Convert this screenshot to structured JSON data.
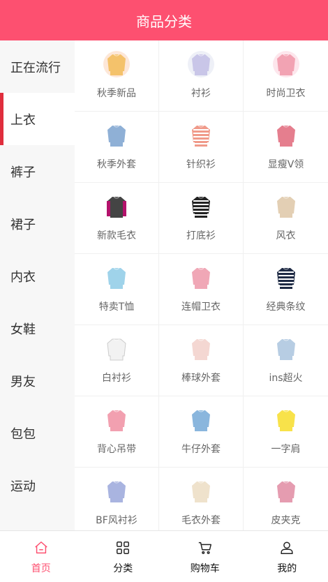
{
  "header": {
    "title": "商品分类"
  },
  "sidebar": {
    "items": [
      {
        "label": "正在流行"
      },
      {
        "label": "上衣"
      },
      {
        "label": "裤子"
      },
      {
        "label": "裙子"
      },
      {
        "label": "内衣"
      },
      {
        "label": "女鞋"
      },
      {
        "label": "男友"
      },
      {
        "label": "包包"
      },
      {
        "label": "运动"
      },
      {
        "label": ""
      }
    ],
    "active_index": 1
  },
  "grid": {
    "items": [
      {
        "label": "秋季新品",
        "icon": "sweater-icon"
      },
      {
        "label": "衬衫",
        "icon": "shirt-icon"
      },
      {
        "label": "时尚卫衣",
        "icon": "hoodie-icon"
      },
      {
        "label": "秋季外套",
        "icon": "jacket-icon"
      },
      {
        "label": "针织衫",
        "icon": "knit-icon"
      },
      {
        "label": "显瘦V领",
        "icon": "vneck-icon"
      },
      {
        "label": "新款毛衣",
        "icon": "sweater-icon"
      },
      {
        "label": "打底衫",
        "icon": "striped-top-icon"
      },
      {
        "label": "风衣",
        "icon": "trench-coat-icon"
      },
      {
        "label": "特卖T恤",
        "icon": "tshirt-icon"
      },
      {
        "label": "连帽卫衣",
        "icon": "hoodie-icon"
      },
      {
        "label": "经典条纹",
        "icon": "striped-top-icon"
      },
      {
        "label": "白衬衫",
        "icon": "shirt-icon"
      },
      {
        "label": "棒球外套",
        "icon": "jacket-icon"
      },
      {
        "label": "ins超火",
        "icon": "top-icon"
      },
      {
        "label": "背心吊带",
        "icon": "camisole-icon"
      },
      {
        "label": "牛仔外套",
        "icon": "denim-jacket-icon"
      },
      {
        "label": "一字肩",
        "icon": "offshoulder-icon"
      },
      {
        "label": "BF风衬衫",
        "icon": "shirt-icon"
      },
      {
        "label": "毛衣外套",
        "icon": "cardigan-icon"
      },
      {
        "label": "皮夹克",
        "icon": "leather-jacket-icon"
      },
      {
        "label": "",
        "icon": "shirt-icon"
      },
      {
        "label": "",
        "icon": "shirt-icon"
      },
      {
        "label": "",
        "icon": "shirt-icon"
      }
    ]
  },
  "tabbar": {
    "items": [
      {
        "label": "首页",
        "icon": "home-icon"
      },
      {
        "label": "分类",
        "icon": "category-icon"
      },
      {
        "label": "购物车",
        "icon": "cart-icon"
      },
      {
        "label": "我的",
        "icon": "user-icon"
      }
    ],
    "active_index": 0
  },
  "colors": {
    "accent": "#fd5070",
    "sidebar_marker": "#e02e3d"
  }
}
